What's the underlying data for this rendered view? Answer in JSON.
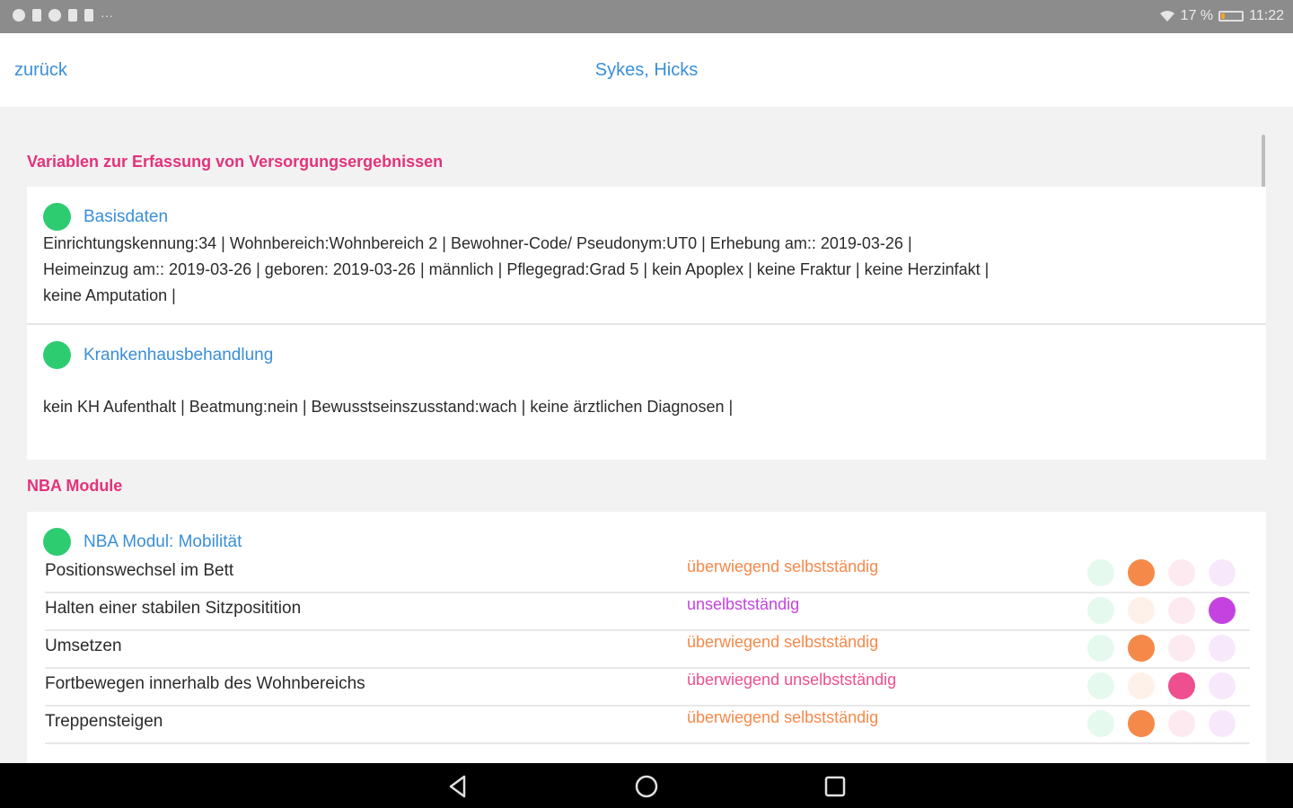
{
  "status_bar": {
    "battery": "17 %",
    "battery_level": 0.17,
    "time": "11:22",
    "icons": [
      "notification-icon",
      "sim-icon",
      "shield-icon",
      "cast-icon",
      "image-icon"
    ],
    "more": "···"
  },
  "header": {
    "back_label": "zurück",
    "title": "Sykes, Hicks"
  },
  "section1": {
    "title": "Variablen zur Erfassung von Versorgungsergebnissen",
    "entries": [
      {
        "title": "Basisdaten",
        "lines": [
          "Einrichtungskennung:34 | Wohnbereich:Wohnbereich 2 | Bewohner-Code/ Pseudonym:UT0 | Erhebung am:: 2019-03-26 |",
          "Heimeinzug am:: 2019-03-26 | geboren: 2019-03-26 | männlich | Pflegegrad:Grad 5 | kein Apoplex | keine Fraktur | keine Herzinfakt |",
          "keine Amputation |"
        ]
      },
      {
        "title": "Krankenhausbehandlung",
        "lines": [
          "kein KH Aufenthalt | Beatmung:nein | Bewusstseinszusstand:wach | keine ärztlichen Diagnosen |"
        ]
      }
    ]
  },
  "section2": {
    "title": "NBA Module",
    "module_title": "NBA Modul: Mobilität",
    "level_colors": [
      "#2ecc71",
      "#f5894a",
      "#ee4f8f",
      "#c443e0"
    ],
    "rows": [
      {
        "label": "Positionswechsel im Bett",
        "status": "überwiegend selbstständig",
        "level": 1
      },
      {
        "label": "Halten einer stabilen Sitzpositition",
        "status": "unselbstständig",
        "level": 3
      },
      {
        "label": "Umsetzen",
        "status": "überwiegend selbstständig",
        "level": 1
      },
      {
        "label": "Fortbewegen innerhalb des Wohnbereichs",
        "status": "überwiegend unselbstständig",
        "level": 2
      },
      {
        "label": "Treppensteigen",
        "status": "überwiegend selbstständig",
        "level": 1
      }
    ]
  },
  "nav": {
    "icons": [
      "back-triangle-icon",
      "home-circle-icon",
      "recents-square-icon"
    ]
  }
}
